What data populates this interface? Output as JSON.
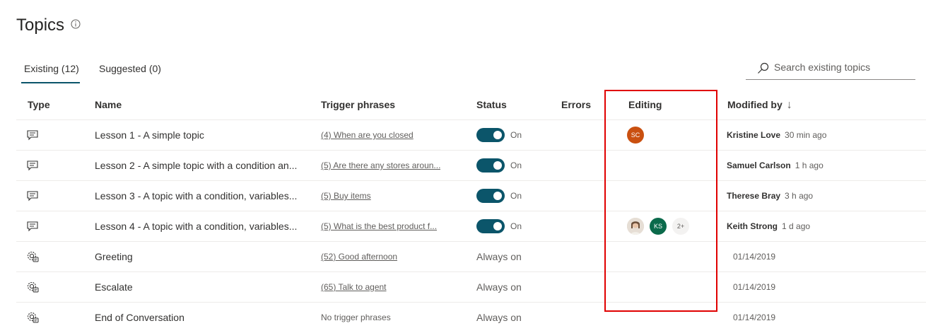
{
  "page": {
    "title": "Topics"
  },
  "tabs": [
    {
      "label": "Existing (12)",
      "selected": true
    },
    {
      "label": "Suggested (0)",
      "selected": false
    }
  ],
  "search": {
    "placeholder": "Search existing topics"
  },
  "columns": {
    "type": "Type",
    "name": "Name",
    "trigger": "Trigger phrases",
    "status": "Status",
    "errors": "Errors",
    "editing": "Editing",
    "modified": "Modified by",
    "modified_sort": "↓"
  },
  "rows": [
    {
      "type_icon": "chat-bubble-icon",
      "name": "Lesson 1 - A simple topic",
      "trigger": "(4) When are you closed",
      "toggle_label": "On",
      "editors": [
        {
          "initials": "SC",
          "color": "#ca5010"
        }
      ],
      "modified_name": "Kristine Love",
      "modified_time": "30 min ago"
    },
    {
      "type_icon": "chat-bubble-icon",
      "name": "Lesson 2 - A simple topic with a condition an...",
      "trigger": "(5) Are there any stores aroun...",
      "toggle_label": "On",
      "editors": [],
      "modified_name": "Samuel Carlson",
      "modified_time": "1 h ago"
    },
    {
      "type_icon": "chat-bubble-icon",
      "name": "Lesson 3 - A topic with a condition, variables...",
      "trigger": "(5) Buy items",
      "toggle_label": "On",
      "editors": [],
      "modified_name": "Therese Bray",
      "modified_time": "3 h ago"
    },
    {
      "type_icon": "chat-bubble-icon",
      "name": "Lesson 4 - A topic with a condition, variables...",
      "trigger": "(5) What is the best product f...",
      "toggle_label": "On",
      "editors": [
        {
          "initials": "",
          "color": "#d8cfc4",
          "photo": true
        },
        {
          "initials": "KS",
          "color": "#0b6a4b"
        }
      ],
      "more_editors": "2+",
      "modified_name": "Keith Strong",
      "modified_time": "1 d ago"
    },
    {
      "type_icon": "system-gear-icon",
      "name": "Greeting",
      "trigger": "(52) Good afternoon",
      "status": "Always on",
      "modified_date": "01/14/2019"
    },
    {
      "type_icon": "system-gear-icon",
      "name": "Escalate",
      "trigger": "(65) Talk to agent",
      "status": "Always on",
      "modified_date": "01/14/2019"
    },
    {
      "type_icon": "system-gear-icon",
      "name": "End of Conversation",
      "trigger": "No trigger phrases",
      "status": "Always on",
      "modified_date": "01/14/2019"
    }
  ],
  "colors": {
    "accent": "#0b556a",
    "highlight": "#e00000"
  }
}
